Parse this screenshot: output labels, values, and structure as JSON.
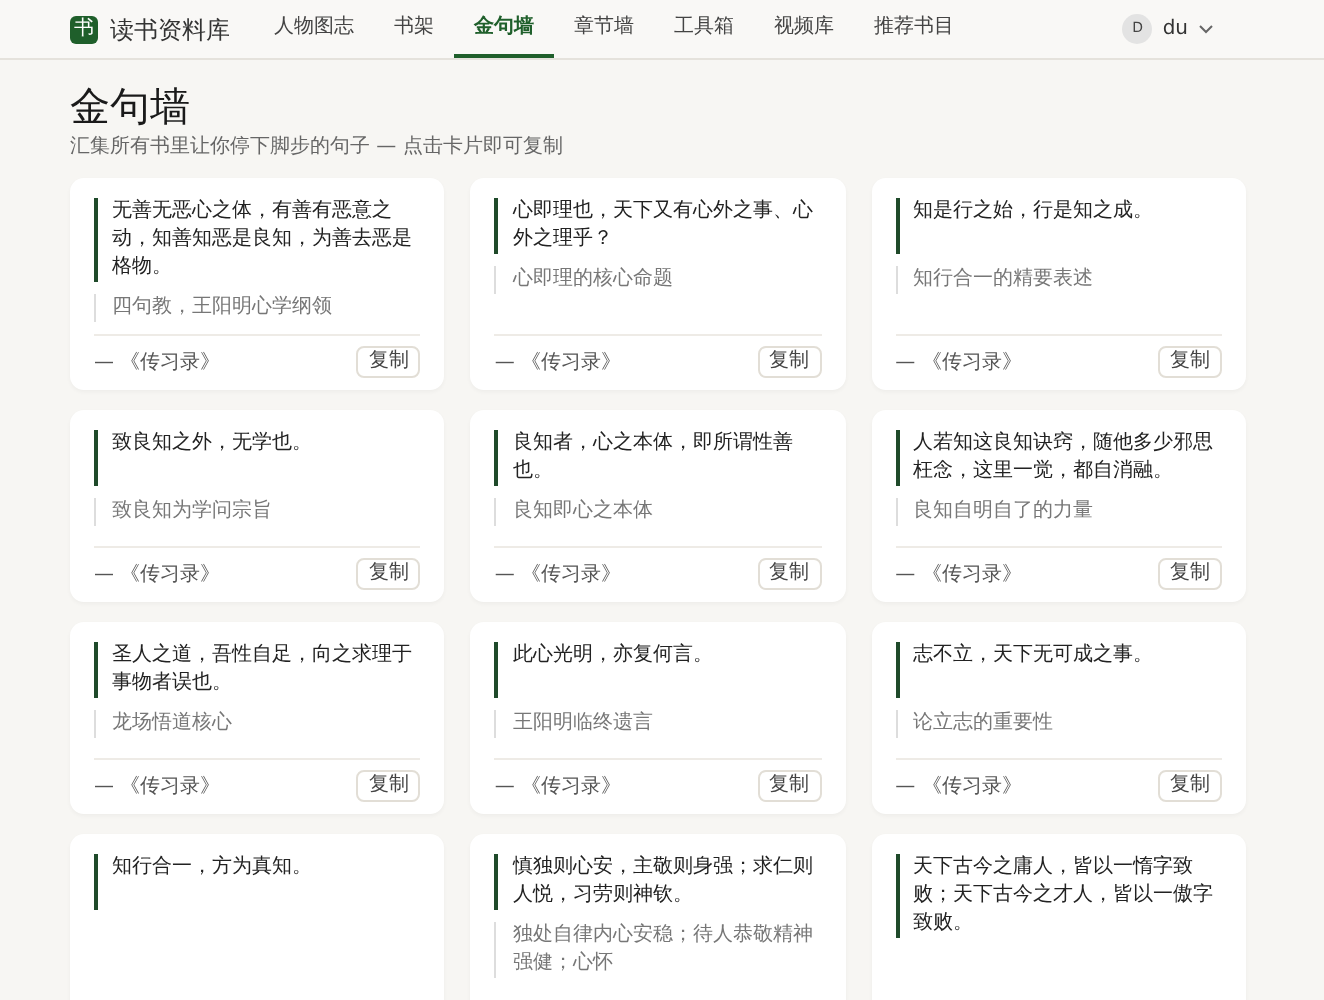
{
  "header": {
    "logo": "书",
    "site_name": "读书资料库",
    "nav": [
      {
        "label": "人物图志",
        "selected": false
      },
      {
        "label": "书架",
        "selected": false
      },
      {
        "label": "金句墙",
        "selected": true
      },
      {
        "label": "章节墙",
        "selected": false
      },
      {
        "label": "工具箱",
        "selected": false
      },
      {
        "label": "视频库",
        "selected": false
      },
      {
        "label": "推荐书目",
        "selected": false
      }
    ],
    "user": {
      "initial": "D",
      "name": "du"
    }
  },
  "page": {
    "title": "金句墙",
    "subtitle": "汇集所有书里让你停下脚步的句子 — 点击卡片即可复制"
  },
  "cards": [
    {
      "quote": "无善无恶心之体，有善有恶意之动，知善知恶是良知，为善去恶是格物。",
      "note": "四句教，王阳明心学纲领",
      "source": "— 《传习录》",
      "button": "复制"
    },
    {
      "quote": "心即理也，天下又有心外之事、心外之理乎？",
      "note": "心即理的核心命题",
      "source": "— 《传习录》",
      "button": "复制"
    },
    {
      "quote": "知是行之始，行是知之成。",
      "note": "知行合一的精要表述",
      "source": "— 《传习录》",
      "button": "复制"
    },
    {
      "quote": "致良知之外，无学也。",
      "note": "致良知为学问宗旨",
      "source": "— 《传习录》",
      "button": "复制"
    },
    {
      "quote": "良知者，心之本体，即所谓性善也。",
      "note": "良知即心之本体",
      "source": "— 《传习录》",
      "button": "复制"
    },
    {
      "quote": "人若知这良知诀窍，随他多少邪思枉念，这里一觉，都自消融。",
      "note": "良知自明自了的力量",
      "source": "— 《传习录》",
      "button": "复制"
    },
    {
      "quote": "圣人之道，吾性自足，向之求理于事物者误也。",
      "note": "龙场悟道核心",
      "source": "— 《传习录》",
      "button": "复制"
    },
    {
      "quote": "此心光明，亦复何言。",
      "note": "王阳明临终遗言",
      "source": "— 《传习录》",
      "button": "复制"
    },
    {
      "quote": "志不立，天下无可成之事。",
      "note": "论立志的重要性",
      "source": "— 《传习录》",
      "button": "复制"
    },
    {
      "quote": "知行合一，方为真知。"
    },
    {
      "quote": "慎独则心安，主敬则身强；求仁则人悦，习劳则神钦。",
      "note": "独处自律内心安稳；待人恭敬精神强健；心怀"
    },
    {
      "quote": "天下古今之庸人，皆以一惰字致败；天下古今之才人，皆以一傲字致败。"
    }
  ]
}
